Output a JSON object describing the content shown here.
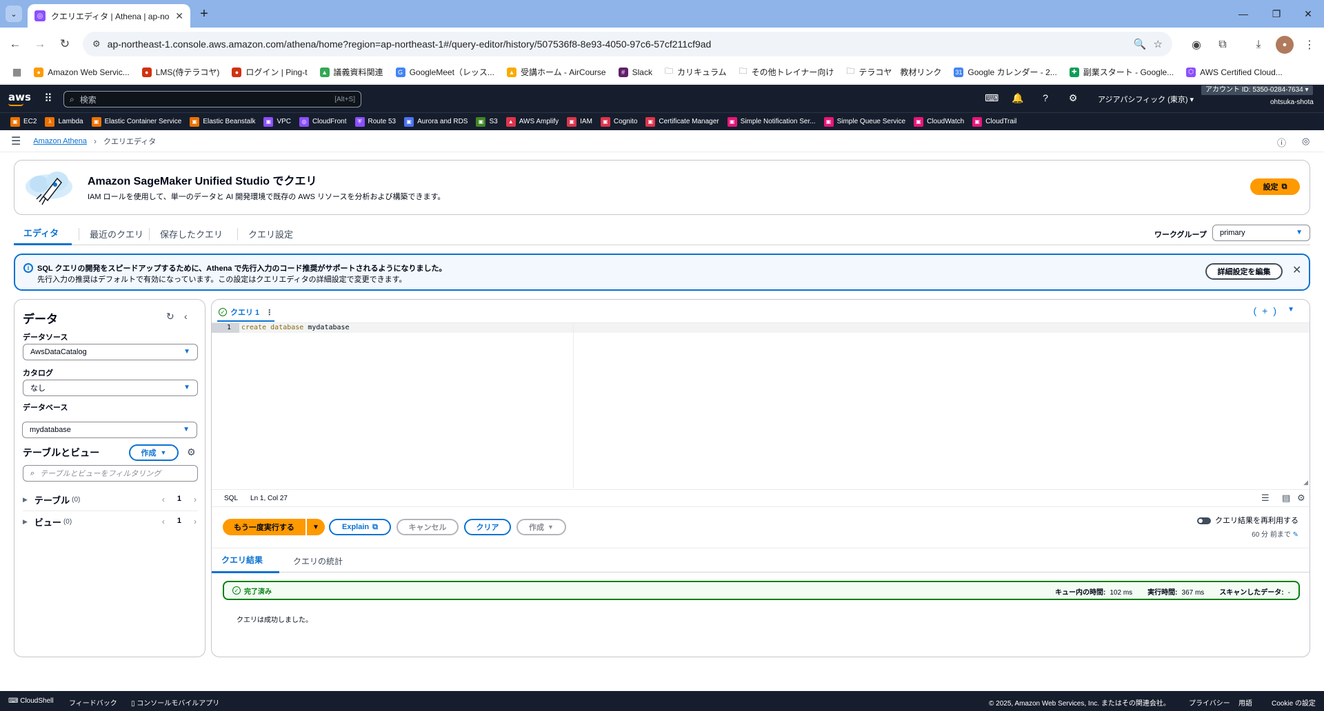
{
  "browser": {
    "tab_title": "クエリエディタ | Athena | ap-northeast-1",
    "url": "ap-northeast-1.console.aws.amazon.com/athena/home?region=ap-northeast-1#/query-editor/history/507536f8-8e93-4050-97c6-57cf211cf9ad",
    "bookmarks": [
      {
        "label": "Amazon Web Servic...",
        "color": "#ff9900"
      },
      {
        "label": "LMS(侍テラコヤ)",
        "color": "#d13212"
      },
      {
        "label": "ログイン | Ping-t",
        "color": "#d13212"
      },
      {
        "label": "議義資料関連",
        "color": "#34a853"
      },
      {
        "label": "GoogleMeet（レッス...",
        "color": "#4285f4"
      },
      {
        "label": "受講ホーム - AirCourse",
        "color": "#f9ab00"
      },
      {
        "label": "Slack",
        "color": "#611f69"
      },
      {
        "label": "カリキュラム",
        "color": "#5f6368"
      },
      {
        "label": "その他トレイナー向け",
        "color": "#5f6368"
      },
      {
        "label": "テラコヤ　教材リンク",
        "color": "#5f6368"
      },
      {
        "label": "Google カレンダー - 2...",
        "color": "#4285f4"
      },
      {
        "label": "副業スタート - Google...",
        "color": "#0f9d58"
      },
      {
        "label": "AWS Certified Cloud...",
        "color": "#8c4fff"
      }
    ]
  },
  "aws": {
    "search_placeholder": "検索",
    "search_shortcut": "[Alt+S]",
    "region": "アジアパシフィック (東京) ▾",
    "account_badge": "アカウント ID: 5350-0284-7634 ▾",
    "user": "ohtsuka-shota",
    "favorites": [
      {
        "label": "EC2",
        "color": "#ed7100"
      },
      {
        "label": "Lambda",
        "color": "#ed7100"
      },
      {
        "label": "Elastic Container Service",
        "color": "#ed7100"
      },
      {
        "label": "Elastic Beanstalk",
        "color": "#ed7100"
      },
      {
        "label": "VPC",
        "color": "#8c4fff"
      },
      {
        "label": "CloudFront",
        "color": "#8c4fff"
      },
      {
        "label": "Route 53",
        "color": "#8c4fff"
      },
      {
        "label": "Aurora and RDS",
        "color": "#4d72f3"
      },
      {
        "label": "S3",
        "color": "#3f8624"
      },
      {
        "label": "AWS Amplify",
        "color": "#dd344c"
      },
      {
        "label": "IAM",
        "color": "#dd344c"
      },
      {
        "label": "Cognito",
        "color": "#dd344c"
      },
      {
        "label": "Certificate Manager",
        "color": "#dd344c"
      },
      {
        "label": "Simple Notification Ser...",
        "color": "#e7157b"
      },
      {
        "label": "Simple Queue Service",
        "color": "#e7157b"
      },
      {
        "label": "CloudWatch",
        "color": "#e7157b"
      },
      {
        "label": "CloudTrail",
        "color": "#e7157b"
      }
    ]
  },
  "breadcrumb": {
    "root": "Amazon Athena",
    "current": "クエリエディタ"
  },
  "promo": {
    "title": "Amazon SageMaker Unified Studio でクエリ",
    "description": "IAM ロールを使用して、単一のデータと AI 開発環境で既存の AWS リソースを分析および構築できます。",
    "button": "設定"
  },
  "main_tabs": [
    "エディタ",
    "最近のクエリ",
    "保存したクエリ",
    "クエリ設定"
  ],
  "workgroup": {
    "label": "ワークグループ",
    "value": "primary"
  },
  "info_banner": {
    "line1": "SQL クエリの開発をスピードアップするために、Athena で先行入力のコード推奨がサポートされるようになりました。",
    "line2": "先行入力の推奨はデフォルトで有効になっています。この設定はクエリエディタの詳細設定で変更できます。",
    "button": "詳細設定を編集"
  },
  "data_panel": {
    "title": "データ",
    "datasource_label": "データソース",
    "datasource_value": "AwsDataCatalog",
    "catalog_label": "カタログ",
    "catalog_value": "なし",
    "database_label": "データベース",
    "database_value": "mydatabase",
    "tables_views_title": "テーブルとビュー",
    "create_button": "作成",
    "filter_placeholder": "テーブルとビューをフィルタリング",
    "tables_label": "テーブル",
    "tables_count": "(0)",
    "tables_page": "1",
    "views_label": "ビュー",
    "views_count": "(0)",
    "views_page": "1"
  },
  "query_panel": {
    "tab_label": "クエリ 1",
    "line_number": "1",
    "code_kw1": "create",
    "code_kw2": "database",
    "code_ident": "mydatabase",
    "lang": "SQL",
    "cursor": "Ln 1, Col 27",
    "run_button": "もう一度実行する",
    "explain_button": "Explain",
    "cancel_button": "キャンセル",
    "clear_button": "クリア",
    "create_button": "作成",
    "reuse_label": "クエリ結果を再利用する",
    "reuse_sub": "60 分 前まで"
  },
  "results": {
    "tab_results": "クエリ結果",
    "tab_stats": "クエリの統計",
    "status": "完了済み",
    "queue_label": "キュー内の時間:",
    "queue_value": "102 ms",
    "exec_label": "実行時間:",
    "exec_value": "367 ms",
    "scan_label": "スキャンしたデータ:",
    "scan_value": "-",
    "message": "クエリは成功しました。"
  },
  "footer": {
    "cloudshell": "CloudShell",
    "feedback": "フィードバック",
    "mobile": "コンソールモバイルアプリ",
    "copyright": "© 2025, Amazon Web Services, Inc. またはその関連会社。",
    "privacy": "プライバシー",
    "terms": "用語",
    "cookie": "Cookie の設定"
  }
}
